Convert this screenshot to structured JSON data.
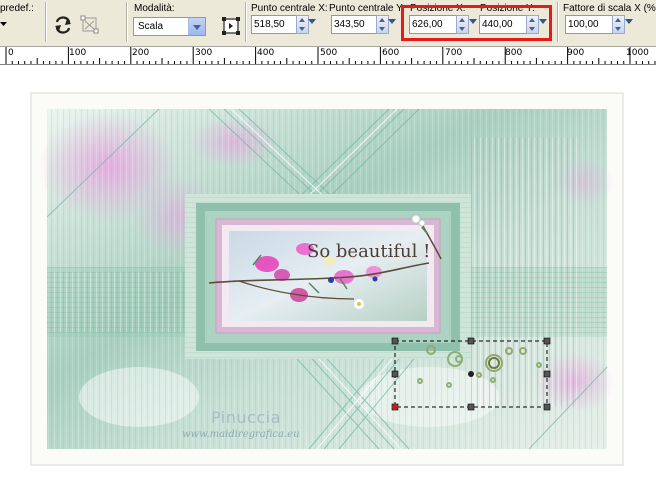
{
  "toolbar": {
    "preset_label": "predef.:",
    "mode_label": "Modalità:",
    "mode_value": "Scala",
    "center_x_label": "Punto centrale X:",
    "center_x_value": "518,50",
    "center_y_label": "Punto centrale Y:",
    "center_y_value": "343,50",
    "pos_x_label": "Posizione X:",
    "pos_x_value": "626,00",
    "pos_y_label": "Posizione Y:",
    "pos_y_value": "440,00",
    "scale_label": "Fattore di scala X (%):",
    "scale_value": "100,00",
    "highlight_color": "#e41b1b",
    "icons": [
      "dropdown-arrow-icon",
      "rotate-icon",
      "deform-icon",
      "reset-icon",
      "spinner-icon"
    ]
  },
  "ruler": {
    "ticks": [
      "0",
      "100",
      "200",
      "300",
      "400",
      "500",
      "600",
      "700",
      "800",
      "900",
      "1000"
    ]
  },
  "canvas": {
    "tube_title": "So beautiful !",
    "watermark_name": "Pinuccia",
    "watermark_url": "www.maidiregrafica.eu",
    "accent_color": "#7fb3a0",
    "frame_color": "#d9b7d4"
  }
}
